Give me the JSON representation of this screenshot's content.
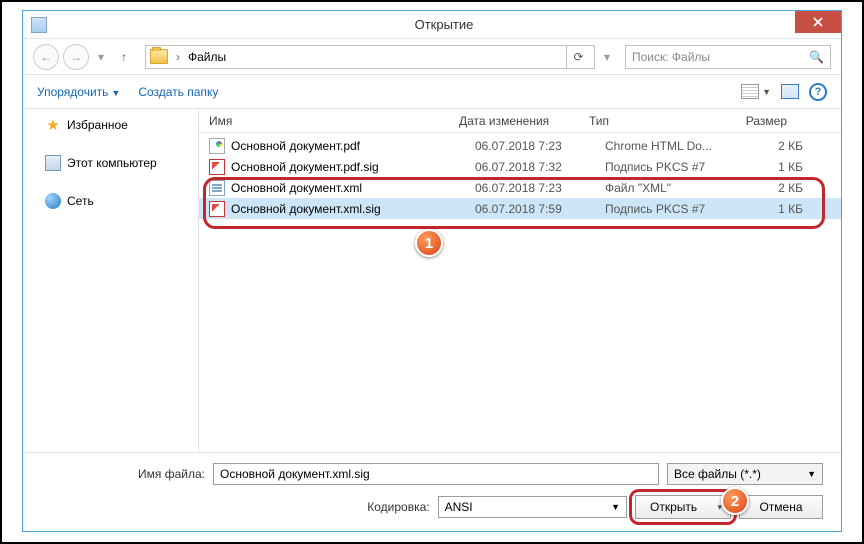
{
  "title": "Открытие",
  "breadcrumb": "Файлы",
  "search_placeholder": "Поиск: Файлы",
  "toolbar": {
    "organize": "Упорядочить",
    "newfolder": "Создать папку"
  },
  "sidebar": {
    "fav": "Избранное",
    "pc": "Этот компьютер",
    "net": "Сеть"
  },
  "cols": {
    "name": "Имя",
    "date": "Дата изменения",
    "type": "Тип",
    "size": "Размер"
  },
  "files": [
    {
      "name": "Основной документ.pdf",
      "date": "06.07.2018 7:23",
      "type": "Chrome HTML Do...",
      "size": "2 КБ",
      "icon": "pdf"
    },
    {
      "name": "Основной документ.pdf.sig",
      "date": "06.07.2018 7:32",
      "type": "Подпись PKCS #7",
      "size": "1 КБ",
      "icon": "sig"
    },
    {
      "name": "Основной документ.xml",
      "date": "06.07.2018 7:23",
      "type": "Файл \"XML\"",
      "size": "2 КБ",
      "icon": "xml"
    },
    {
      "name": "Основной документ.xml.sig",
      "date": "06.07.2018 7:59",
      "type": "Подпись PKCS #7",
      "size": "1 КБ",
      "icon": "sig"
    }
  ],
  "footer": {
    "filename_label": "Имя файла:",
    "filename_value": "Основной документ.xml.sig",
    "filter": "Все файлы (*.*)",
    "encoding_label": "Кодировка:",
    "encoding_value": "ANSI",
    "open": "Открыть",
    "cancel": "Отмена"
  },
  "badges": {
    "b1": "1",
    "b2": "2"
  }
}
